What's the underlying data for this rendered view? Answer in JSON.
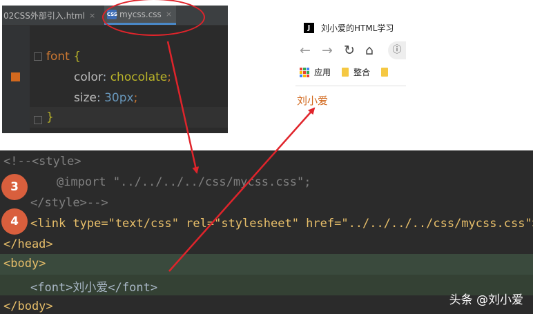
{
  "css_editor": {
    "tabs": [
      {
        "label": "02CSS外部引入.html"
      },
      {
        "label": "mycss.css",
        "icon": "css-file-icon"
      }
    ],
    "lines": {
      "selector": "font",
      "open_brace": "{",
      "prop1": "color",
      "val1": "chocolate",
      "prop2": "size",
      "val2": "30px",
      "close_brace": "}"
    },
    "close_glyph": "×",
    "swatch_color": "#d2691e"
  },
  "browser": {
    "title": "刘小爱的HTML学习",
    "bookmarks": [
      "应用",
      "整合"
    ],
    "content_text": "刘小爱"
  },
  "html_editor": {
    "lines": [
      "<!--<style>",
      "@import \"../../../../css/mycss.css\";",
      "</style>-->",
      "<link type=\"text/css\" rel=\"stylesheet\" href=\"../../../../css/mycss.css\">",
      "</head>",
      "<body>",
      "<font>刘小爱</font>",
      "</body>"
    ],
    "badges": [
      "3",
      "4"
    ]
  },
  "watermark": "头条 @刘小爱",
  "annotation_color": "#e0242b"
}
